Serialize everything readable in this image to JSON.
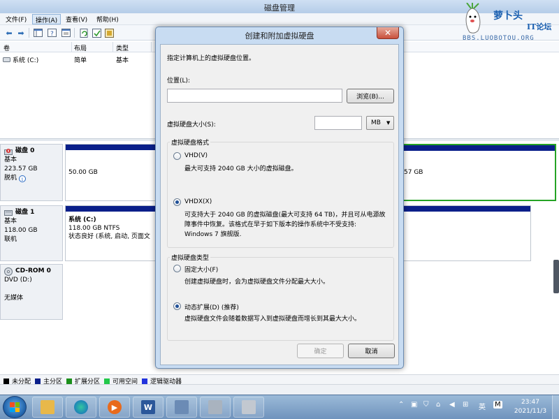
{
  "window": {
    "title": "磁盘管理"
  },
  "menu": [
    {
      "label": "文件(F)"
    },
    {
      "label": "操作(A)"
    },
    {
      "label": "查看(V)"
    },
    {
      "label": "帮助(H)"
    }
  ],
  "volume_list": {
    "columns": [
      "卷",
      "布局",
      "类型"
    ],
    "rows": [
      {
        "volume": "系统 (C:)",
        "layout": "简单",
        "type": "基本"
      }
    ]
  },
  "disks": [
    {
      "name": "磁盘 0",
      "kind": "基本",
      "size": "223.57 GB",
      "status": "脱机",
      "partition_left": "50.00 GB",
      "partition_right": "57 GB"
    },
    {
      "name": "磁盘 1",
      "kind": "基本",
      "size": "118.00 GB",
      "status": "联机",
      "partition_name": "系统 (C:)",
      "partition_size": "118.00 GB NTFS",
      "partition_status": "状态良好 (系统, 启动, 页面文"
    },
    {
      "name": "CD-ROM 0",
      "kind": "DVD (D:)",
      "status": "无媒体"
    }
  ],
  "legend": [
    {
      "label": "未分配",
      "color": "#000000"
    },
    {
      "label": "主分区",
      "color": "#0a1f8a"
    },
    {
      "label": "扩展分区",
      "color": "#1b8f1b"
    },
    {
      "label": "可用空间",
      "color": "#22c84a"
    },
    {
      "label": "逻辑驱动器",
      "color": "#2233dd"
    }
  ],
  "watermark": {
    "line1": "萝卜头",
    "line2": "IT论坛",
    "line3": "BBS.LUOBOTOU.ORG"
  },
  "dialog": {
    "title": "创建和附加虚拟硬盘",
    "close_label": "✕",
    "instruction": "指定计算机上的虚拟硬盘位置。",
    "location_label": "位置(L):",
    "location_value": "",
    "browse_label": "浏览(B)...",
    "size_label": "虚拟硬盘大小(S):",
    "size_value": "",
    "unit_value": "MB",
    "format_group": "虚拟硬盘格式",
    "vhd_label": "VHD(V)",
    "vhd_desc": "最大可支持 2040 GB 大小的虚拟磁盘。",
    "vhdx_label": "VHDX(X)",
    "vhdx_desc_1": "可支持大于 2040 GB 的虚拟磁盘(最大可支持 64 TB)，并且可从电源故",
    "vhdx_desc_2": "障事件中恢复。该格式在早于如下版本的操作系统中不受支持:",
    "vhdx_desc_3": "Windows 7 旗舰版.",
    "type_group": "虚拟硬盘类型",
    "fixed_label": "固定大小(F)",
    "fixed_desc": "创建虚拟硬盘时，会为虚拟硬盘文件分配最大大小。",
    "dynamic_label": "动态扩展(D) (推荐)",
    "dynamic_desc": "虚拟硬盘文件会随着数据写入到虚拟硬盘而增长到其最大大小。",
    "ok_label": "确定",
    "cancel_label": "取消"
  },
  "taskbar": {
    "word_label": "W",
    "ime_label": "英",
    "ime_mode": "M",
    "time": "23:47",
    "date": "2021/11/3"
  }
}
